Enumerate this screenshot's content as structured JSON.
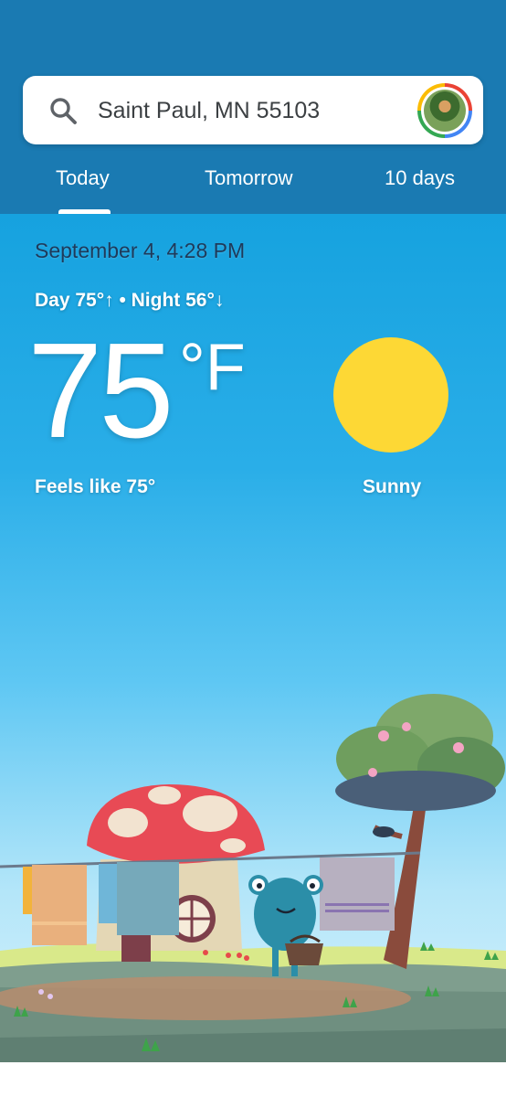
{
  "search": {
    "location": "Saint Paul, MN 55103"
  },
  "tabs": [
    {
      "label": "Today",
      "active": true
    },
    {
      "label": "Tomorrow",
      "active": false
    },
    {
      "label": "10 days",
      "active": false
    }
  ],
  "current": {
    "datetime": "September 4, 4:28 PM",
    "day_night": "Day 75°↑ • Night 56°↓",
    "temperature": "75",
    "unit": "°F",
    "feels_like": "Feels like 75°",
    "condition": "Sunny",
    "condition_icon": "sun-icon"
  },
  "colors": {
    "header": "#1a7ab2",
    "sky_top": "#16a2df",
    "sun": "#fdd835"
  }
}
